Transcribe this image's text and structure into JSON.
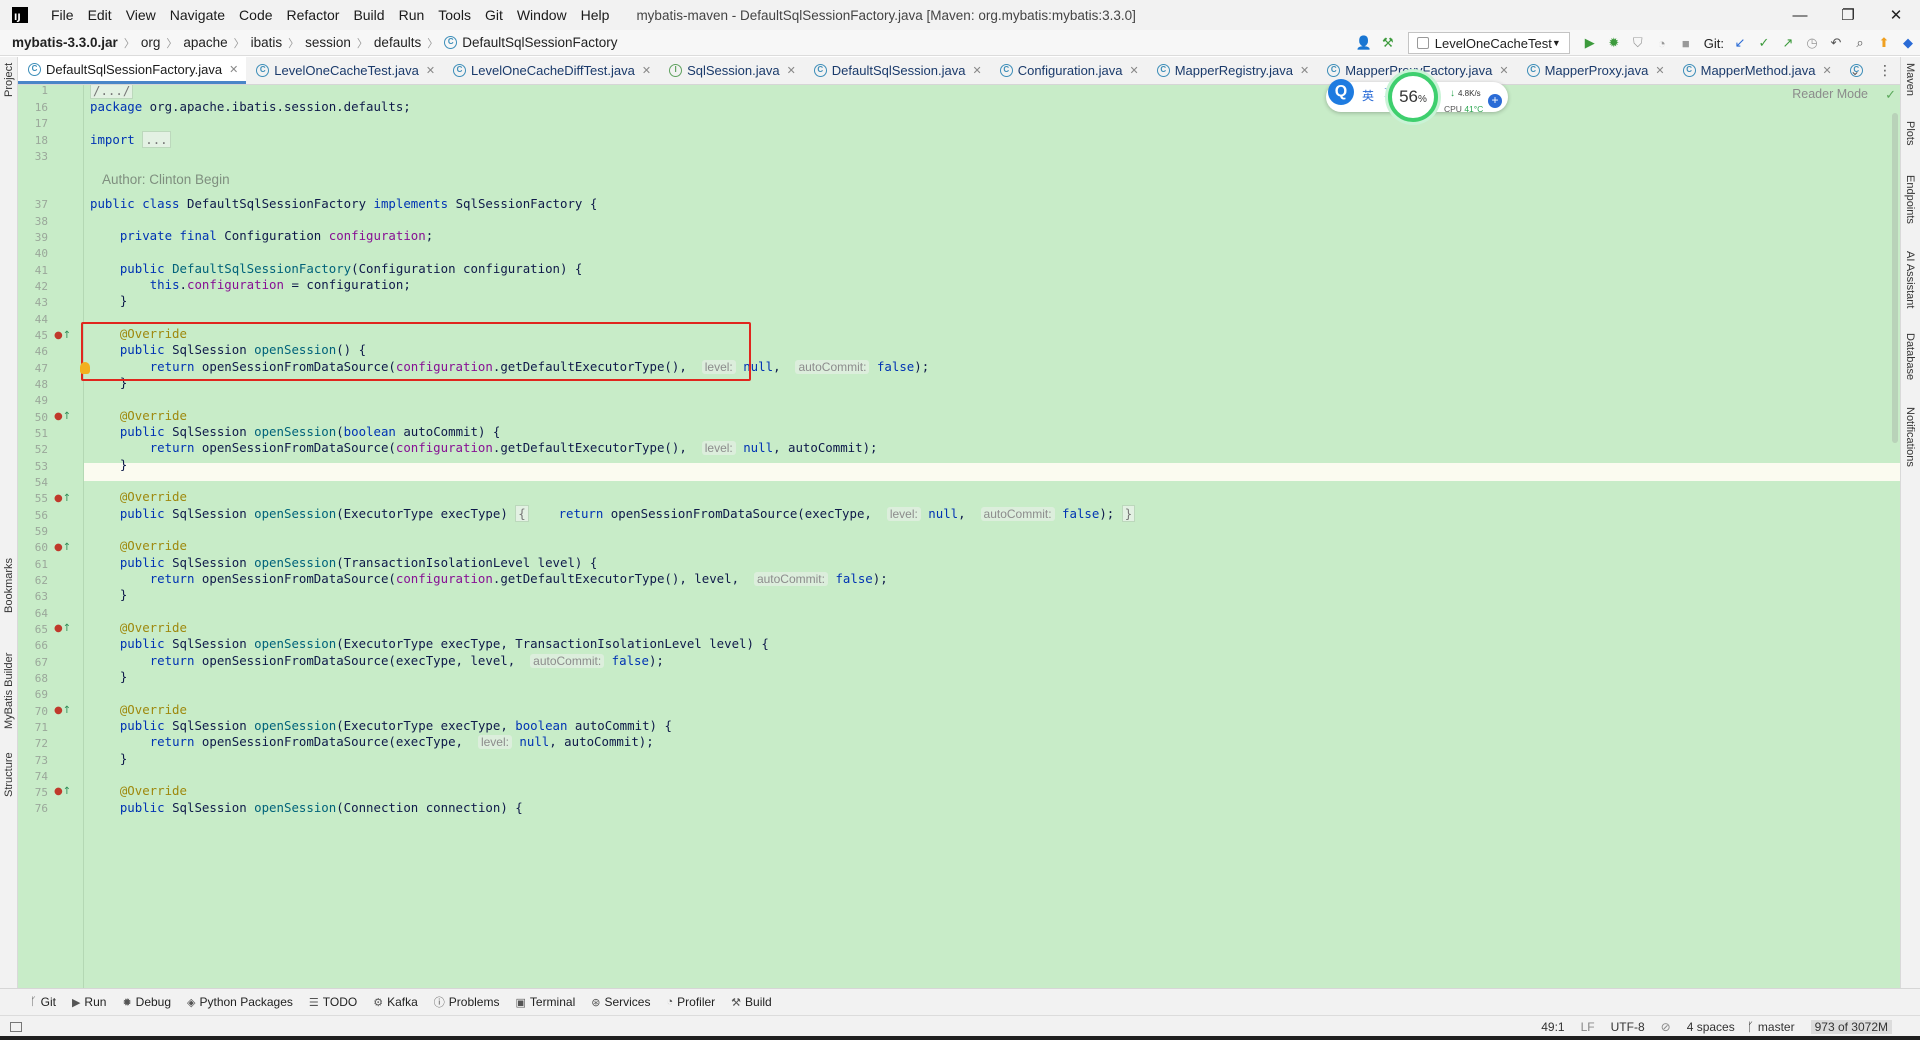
{
  "app": {
    "logo_text": "IJ",
    "menu": [
      "File",
      "Edit",
      "View",
      "Navigate",
      "Code",
      "Refactor",
      "Build",
      "Run",
      "Tools",
      "Git",
      "Window",
      "Help"
    ],
    "window_title": "mybatis-maven - DefaultSqlSessionFactory.java [Maven: org.mybatis:mybatis:3.3.0]",
    "controls": {
      "minimize": "—",
      "maximize": "❐",
      "close": "✕"
    }
  },
  "breadcrumb": [
    "mybatis-3.3.0.jar",
    "org",
    "apache",
    "ibatis",
    "session",
    "defaults",
    "DefaultSqlSessionFactory"
  ],
  "toolbar": {
    "run_config": "LevelOneCacheTest",
    "git_label": "Git:"
  },
  "tabs": [
    {
      "label": "DefaultSqlSessionFactory.java",
      "kind": "class"
    },
    {
      "label": "LevelOneCacheTest.java",
      "kind": "class"
    },
    {
      "label": "LevelOneCacheDiffTest.java",
      "kind": "class"
    },
    {
      "label": "SqlSession.java",
      "kind": "iface"
    },
    {
      "label": "DefaultSqlSession.java",
      "kind": "class"
    },
    {
      "label": "Configuration.java",
      "kind": "class"
    },
    {
      "label": "MapperRegistry.java",
      "kind": "class"
    },
    {
      "label": "MapperProxyFactory.java",
      "kind": "class"
    },
    {
      "label": "MapperProxy.java",
      "kind": "class"
    },
    {
      "label": "MapperMethod.java",
      "kind": "class"
    }
  ],
  "left_strip": [
    "Project",
    "Bookmarks",
    "MyBatis Builder",
    "Structure"
  ],
  "right_strip": [
    "Maven",
    "Plots",
    "Endpoints",
    "AI Assistant",
    "Database",
    "Notifications"
  ],
  "editor": {
    "reader_mode": "Reader Mode",
    "author": "Author: Clinton Begin",
    "line_numbers": [
      "1",
      "16",
      "17",
      "18",
      "33",
      "",
      "37",
      "38",
      "39",
      "40",
      "41",
      "42",
      "43",
      "44",
      "45",
      "46",
      "47",
      "48",
      "49",
      "50",
      "51",
      "52",
      "53",
      "54",
      "55",
      "56",
      "59",
      "60",
      "61",
      "62",
      "63",
      "64",
      "65",
      "66",
      "67",
      "68",
      "69",
      "70",
      "71",
      "72",
      "73",
      "74",
      "75",
      "76"
    ]
  },
  "widget": {
    "lang": "英",
    "gauge_value": "56",
    "gauge_unit": "%",
    "speed": "4.8K/s",
    "cpu_label": "CPU",
    "cpu_temp": "41°C"
  },
  "toolwindows": [
    "Git",
    "Run",
    "Debug",
    "Python Packages",
    "TODO",
    "Kafka",
    "Problems",
    "Terminal",
    "Services",
    "Profiler",
    "Build"
  ],
  "status": {
    "position": "49:1",
    "line_sep": "LF",
    "encoding": "UTF-8",
    "indent": "4 spaces",
    "branch": "master",
    "memory": "973 of 3072M"
  },
  "colors": {
    "editor_bg": "#c8ecc8",
    "highlight_box": "#e0261e",
    "keyword": "#0033b3",
    "field": "#871094",
    "annotation": "#9e880d"
  }
}
